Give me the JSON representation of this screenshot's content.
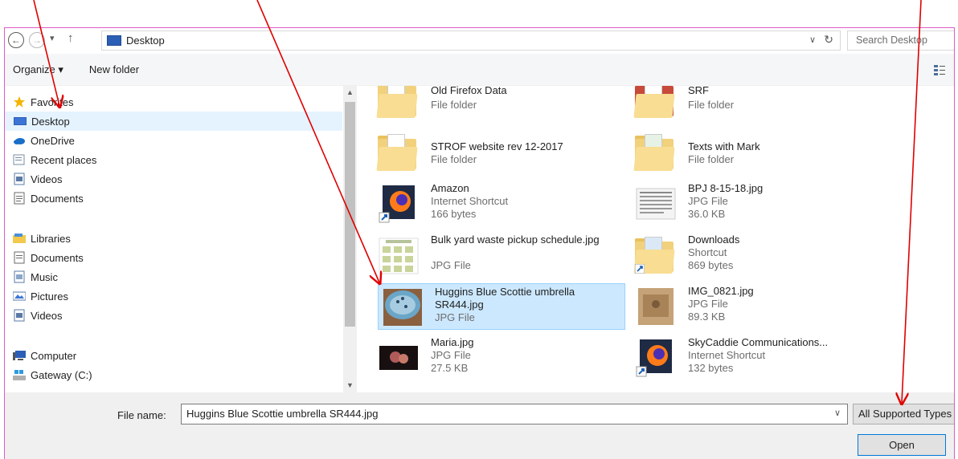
{
  "address_bar": {
    "back_glyph": "←",
    "forward_glyph": "→",
    "recent_glyph": "▾",
    "up_glyph": "↑",
    "path": "Desktop",
    "dropdown_glyph": "∨",
    "refresh_glyph": "↻",
    "search_placeholder": "Search Desktop"
  },
  "toolbar": {
    "organize_label": "Organize ▾",
    "new_folder_label": "New folder"
  },
  "sidebar": {
    "favorites": {
      "label": "Favorites",
      "items": [
        {
          "label": "Desktop",
          "icon": "desktop-icon",
          "selected": true
        },
        {
          "label": "OneDrive",
          "icon": "onedrive-icon"
        },
        {
          "label": "Recent places",
          "icon": "recent-places-icon"
        },
        {
          "label": "Videos",
          "icon": "videos-icon"
        },
        {
          "label": "Documents",
          "icon": "documents-icon"
        }
      ]
    },
    "libraries": {
      "label": "Libraries",
      "items": [
        {
          "label": "Documents",
          "icon": "documents-icon"
        },
        {
          "label": "Music",
          "icon": "music-icon"
        },
        {
          "label": "Pictures",
          "icon": "pictures-icon"
        },
        {
          "label": "Videos",
          "icon": "videos-icon"
        }
      ]
    },
    "computer": {
      "label": "Computer",
      "items": [
        {
          "label": "Gateway (C:)",
          "icon": "drive-icon"
        }
      ]
    }
  },
  "files": [
    {
      "name": "Old Firefox Data",
      "line1": "File folder",
      "line2": "",
      "kind": "folder"
    },
    {
      "name": "SRF",
      "line1": "File folder",
      "line2": "",
      "kind": "folder"
    },
    {
      "name": "STROF website rev 12-2017",
      "line1": "File folder",
      "line2": "",
      "kind": "folder"
    },
    {
      "name": "Texts with Mark",
      "line1": "File folder",
      "line2": "",
      "kind": "folder"
    },
    {
      "name": "Amazon",
      "line1": "Internet Shortcut",
      "line2": "166 bytes",
      "kind": "firefox-shortcut"
    },
    {
      "name": "BPJ 8-15-18.jpg",
      "line1": "JPG File",
      "line2": "36.0 KB",
      "kind": "document-image"
    },
    {
      "name": "Bulk yard waste pickup schedule.jpg",
      "line1": "JPG File",
      "line2": "",
      "kind": "schedule-image"
    },
    {
      "name": "Downloads",
      "line1": "Shortcut",
      "line2": "869 bytes",
      "kind": "folder-shortcut"
    },
    {
      "name": "Huggins Blue Scottie umbrella SR444.jpg",
      "line1": "JPG File",
      "line2": "",
      "kind": "umbrella-image",
      "selected": true
    },
    {
      "name": "IMG_0821.jpg",
      "line1": "JPG File",
      "line2": "89.3 KB",
      "kind": "photo-image"
    },
    {
      "name": "Maria.jpg",
      "line1": "JPG File",
      "line2": "27.5 KB",
      "kind": "portrait-image"
    },
    {
      "name": "SkyCaddie Communications...",
      "line1": "Internet Shortcut",
      "line2": "132 bytes",
      "kind": "firefox-shortcut"
    }
  ],
  "bottom_bar": {
    "file_name_label": "File name:",
    "file_name_value": "Huggins Blue Scottie umbrella SR444.jpg",
    "dropdown_glyph": "∨",
    "file_type": "All Supported Types",
    "open_label": "Open"
  },
  "colors": {
    "selection": "#cce8ff",
    "selection_border": "#99d1ff",
    "annotation": "#e00000",
    "frame": "#e05cc8",
    "accent": "#0078d7"
  }
}
